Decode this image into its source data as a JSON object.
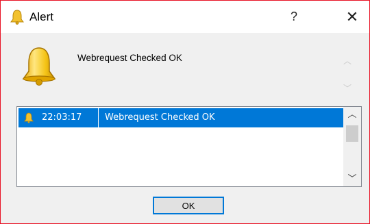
{
  "window": {
    "title": "Alert",
    "help_label": "?",
    "close_label": "✕"
  },
  "message": {
    "text": "Webrequest Checked OK"
  },
  "list": {
    "rows": [
      {
        "time": "22:03:17",
        "message": "Webrequest Checked OK",
        "selected": true
      }
    ]
  },
  "buttons": {
    "ok_label": "OK"
  },
  "icons": {
    "title": "bell-icon",
    "main": "bell-icon",
    "row": "bell-icon"
  },
  "colors": {
    "selection": "#0078d7",
    "window_border": "#e81123",
    "bell": "#f2c12e"
  }
}
